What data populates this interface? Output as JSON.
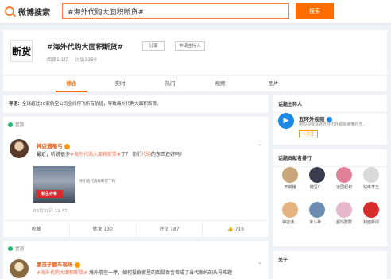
{
  "topbar": {
    "logo_text": "微博搜索",
    "search_value": "#海外代购大面积断货#",
    "search_button": "搜索"
  },
  "topic": {
    "logo_text": "断货",
    "title": "#海外代购大面积断货#",
    "share_label": "分享",
    "host_label": "申请主持人",
    "reads": "阅读1.1亿",
    "discussions": "讨论3350"
  },
  "tabs": [
    {
      "label": "综合",
      "active": true
    },
    {
      "label": "实时",
      "active": false
    },
    {
      "label": "热门",
      "active": false
    },
    {
      "label": "视频",
      "active": false
    },
    {
      "label": "图片",
      "active": false
    }
  ],
  "lead": {
    "label": "导语：",
    "text": "全球超过20家航空公司全线停飞所有航班，导致海外代购大面积断货。"
  },
  "posts": [
    {
      "pinned_label": "置顶",
      "user": "神店通喵弓",
      "text_pre": "最近，听说很多",
      "tag": "#海外代购大面积断货#",
      "text_mid": "了？ 你们",
      "keyword": "代购",
      "text_post": "的东西还好吗?",
      "image_stamp": "私生存寄",
      "image_caption": "你们也代购有断货了吗",
      "time": "03月31日 11:47",
      "actions": {
        "collect": "收藏",
        "repost": "转发 130",
        "comment": "评论 187",
        "like": "716"
      }
    },
    {
      "pinned_label": "置顶",
      "user": "黑孩子翻车现场",
      "text_pre": "",
      "tag": "#海外代购大面积断货#",
      "text_post": " 境外航空一停，如何投食家里的四脚吞金兽成了当代家妈的头号难题"
    }
  ],
  "sidebar": {
    "host_title": "话题主持人",
    "host_name": "五环外视频",
    "host_desc": "用短视频讲述五环内外都能读懂的五...",
    "follow_label": "+关注",
    "contrib_title": "话题贡献者排行",
    "contributors": [
      {
        "name": "开锄猪",
        "color": "#c9a57a"
      },
      {
        "name": "糖豆C...",
        "color": "#3b3b4f"
      },
      {
        "name": "凌国起初",
        "color": "#e27f9a"
      },
      {
        "name": "钱练李王",
        "color": "#d9d9d9"
      },
      {
        "name": "神店通...",
        "color": "#e6b380"
      },
      {
        "name": "米斗拳...",
        "color": "#6e8cb3"
      },
      {
        "name": "超玛群群",
        "color": "#e8b6c9"
      },
      {
        "name": "封面新闻",
        "color": "#d62c2c"
      }
    ],
    "about_title": "关于"
  }
}
